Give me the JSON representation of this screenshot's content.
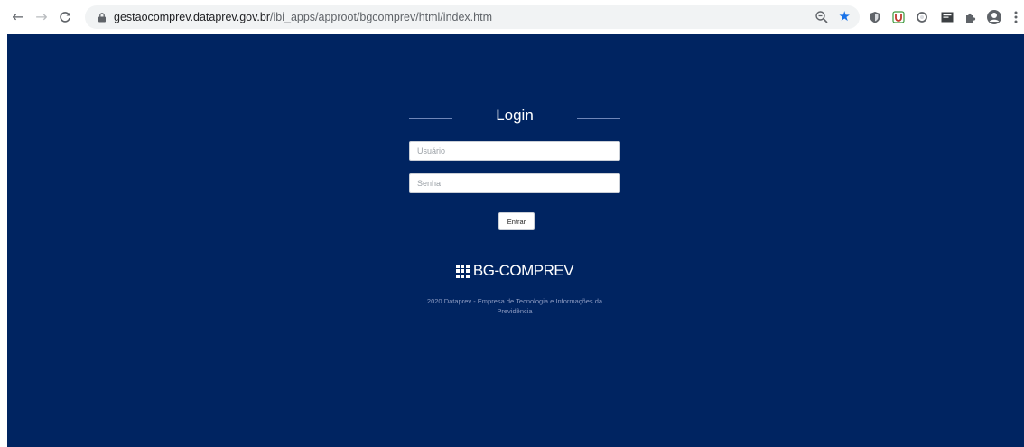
{
  "browser": {
    "url_host": "gestaocomprev.dataprev.gov.br",
    "url_path": "/ibi_apps/approot/bgcomprev/html/index.htm",
    "nav_icons": [
      "back-arrow-icon",
      "forward-arrow-icon",
      "reload-icon"
    ],
    "omnibox_icons": [
      "lock-icon",
      "zoom-icon",
      "bookmark-star-icon"
    ],
    "extension_icons": [
      "shield-extension-icon",
      "ublock-extension-icon",
      "circle-extension-icon",
      "dark-extension-icon",
      "puzzle-extensions-icon",
      "profile-icon",
      "kebab-menu-icon"
    ]
  },
  "login": {
    "title": "Login",
    "username_placeholder": "Usuário",
    "password_placeholder": "Senha",
    "submit_label": "Entrar"
  },
  "brand": {
    "name": "BG-COMPREV",
    "icon": "grid-icon"
  },
  "footer": {
    "line1": "2020 Dataprev - Empresa de Tecnologia e Informações da",
    "line2": "Previdência"
  },
  "colors": {
    "page_background": "#002461",
    "accent_star": "#1a73e8",
    "text_white": "#ffffff",
    "footer_text": "#8b9ac1"
  }
}
